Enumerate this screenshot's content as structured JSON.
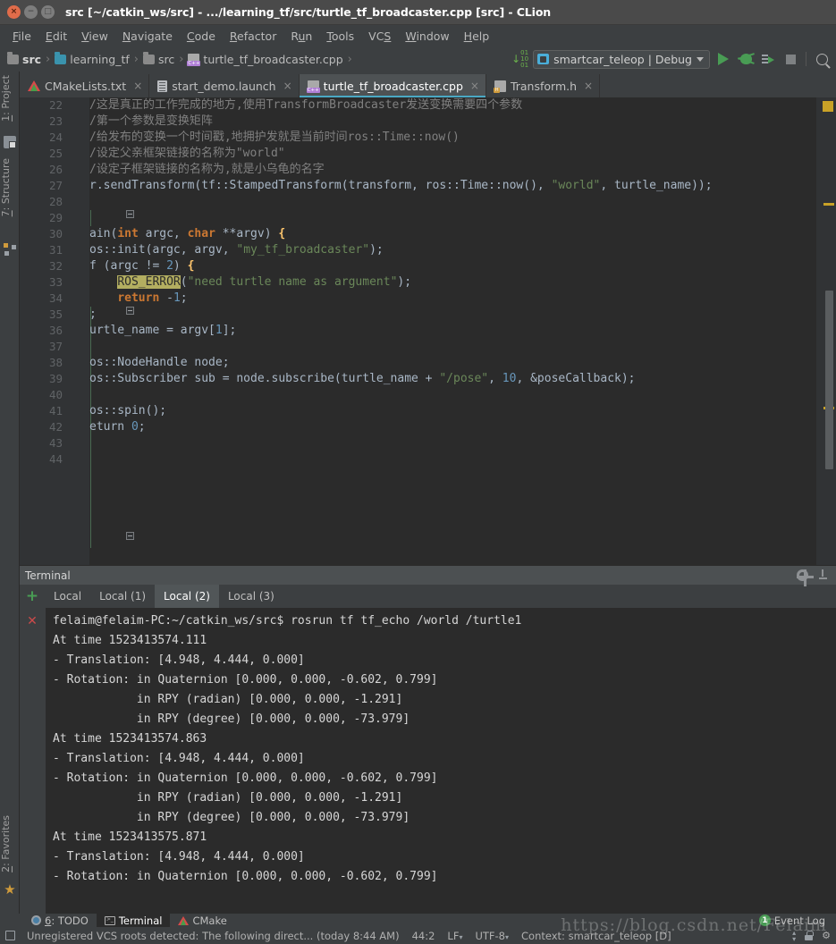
{
  "window": {
    "title": "src [~/catkin_ws/src] - .../learning_tf/src/turtle_tf_broadcaster.cpp [src] - CLion",
    "close_glyph": "×",
    "min_glyph": "−",
    "max_glyph": "□"
  },
  "menubar": {
    "items": [
      {
        "pre": "",
        "mn": "F",
        "post": "ile"
      },
      {
        "pre": "",
        "mn": "E",
        "post": "dit"
      },
      {
        "pre": "",
        "mn": "V",
        "post": "iew"
      },
      {
        "pre": "",
        "mn": "N",
        "post": "avigate"
      },
      {
        "pre": "",
        "mn": "C",
        "post": "ode"
      },
      {
        "pre": "",
        "mn": "R",
        "post": "efactor"
      },
      {
        "pre": "R",
        "mn": "u",
        "post": "n"
      },
      {
        "pre": "",
        "mn": "T",
        "post": "ools"
      },
      {
        "pre": "VC",
        "mn": "S",
        "post": ""
      },
      {
        "pre": "",
        "mn": "W",
        "post": "indow"
      },
      {
        "pre": "",
        "mn": "H",
        "post": "elp"
      }
    ]
  },
  "breadcrumbs": {
    "separator": "›",
    "items": [
      {
        "label": "src",
        "icon": "folder-icon",
        "bold": true
      },
      {
        "label": "learning_tf",
        "icon": "folder-blue-icon",
        "bold": false
      },
      {
        "label": "src",
        "icon": "folder-icon",
        "bold": false
      },
      {
        "label": "turtle_tf_broadcaster.cpp",
        "icon": "cpp-file-icon",
        "bold": false
      }
    ]
  },
  "toolbar": {
    "run_config": "smartcar_teleop | Debug",
    "sort_icon": "sort-numeric-icon",
    "run_icon": "run-icon",
    "debug_icon": "debug-icon",
    "attach_icon": "attach-to-process-icon",
    "stop_icon": "stop-icon",
    "search_icon": "search-everywhere-icon"
  },
  "left_strip": {
    "project": {
      "pre": "",
      "mn": "1",
      "post": ": Project"
    },
    "structure": {
      "pre": "",
      "mn": "7",
      "post": ": Structure"
    },
    "favorites": {
      "pre": "",
      "mn": "2",
      "post": ": Favorites"
    }
  },
  "editor_tabs": [
    {
      "label": "CMakeLists.txt",
      "icon": "cmake-icon",
      "active": false,
      "close": "×"
    },
    {
      "label": "start_demo.launch",
      "icon": "launch-file-icon",
      "active": false,
      "close": "×"
    },
    {
      "label": "turtle_tf_broadcaster.cpp",
      "icon": "cpp-file-icon",
      "active": true,
      "close": "×"
    },
    {
      "label": "Transform.h",
      "icon": "header-file-icon",
      "active": false,
      "close": "×"
    }
  ],
  "editor": {
    "first_line": 22,
    "last_line": 44,
    "line_numbers": [
      22,
      23,
      24,
      25,
      26,
      27,
      28,
      29,
      30,
      31,
      32,
      33,
      34,
      35,
      36,
      37,
      38,
      39,
      40,
      41,
      42,
      43,
      44
    ],
    "lines": [
      {
        "n": 22,
        "text": "/这是真正的工作完成的地方,使用TransformBroadcaster发送变换需要四个参数"
      },
      {
        "n": 23,
        "text": "/第一个参数是变换矩阵"
      },
      {
        "n": 24,
        "text": "/给发布的变换一个时间戳,地拥护发就是当前时间ros::Time::now()"
      },
      {
        "n": 25,
        "text": "/设定父亲框架链接的名称为\"world\""
      },
      {
        "n": 26,
        "text": "/设定子框架链接的名称为,就是小乌龟的名字"
      },
      {
        "n": 27,
        "text": "r.sendTransform(tf::StampedTransform(transform, ros::Time::now(), \"world\", turtle_name));"
      },
      {
        "n": 28,
        "text": ""
      },
      {
        "n": 29,
        "text": ""
      },
      {
        "n": 30,
        "text": "ain(int argc, char **argv) {"
      },
      {
        "n": 31,
        "text": "os::init(argc, argv, \"my_tf_broadcaster\");"
      },
      {
        "n": 32,
        "text": "f (argc != 2) {"
      },
      {
        "n": 33,
        "text": "    ROS_ERROR(\"need turtle name as argument\");"
      },
      {
        "n": 34,
        "text": "    return -1;"
      },
      {
        "n": 35,
        "text": ";"
      },
      {
        "n": 36,
        "text": "urtle_name = argv[1];"
      },
      {
        "n": 37,
        "text": ""
      },
      {
        "n": 38,
        "text": "os::NodeHandle node;"
      },
      {
        "n": 39,
        "text": "os::Subscriber sub = node.subscribe(turtle_name + \"/pose\", 10, &poseCallback);"
      },
      {
        "n": 40,
        "text": ""
      },
      {
        "n": 41,
        "text": "os::spin();"
      },
      {
        "n": 42,
        "text": "eturn 0;"
      },
      {
        "n": 43,
        "text": ""
      },
      {
        "n": 44,
        "text": ""
      }
    ]
  },
  "terminal": {
    "panel_title": "Terminal",
    "gear_icon": "settings-gear-icon",
    "hide_icon": "hide-panel-icon",
    "add_tab": "+",
    "tabs": [
      {
        "label": "Local",
        "active": false
      },
      {
        "label": "Local (1)",
        "active": false
      },
      {
        "label": "Local (2)",
        "active": true
      },
      {
        "label": "Local (3)",
        "active": false
      }
    ],
    "close_session_icon": "close-session-icon",
    "output": [
      "felaim@felaim-PC:~/catkin_ws/src$ rosrun tf tf_echo /world /turtle1",
      "At time 1523413574.111",
      "- Translation: [4.948, 4.444, 0.000]",
      "- Rotation: in Quaternion [0.000, 0.000, -0.602, 0.799]",
      "            in RPY (radian) [0.000, 0.000, -1.291]",
      "            in RPY (degree) [0.000, 0.000, -73.979]",
      "At time 1523413574.863",
      "- Translation: [4.948, 4.444, 0.000]",
      "- Rotation: in Quaternion [0.000, 0.000, -0.602, 0.799]",
      "            in RPY (radian) [0.000, 0.000, -1.291]",
      "            in RPY (degree) [0.000, 0.000, -73.979]",
      "At time 1523413575.871",
      "- Translation: [4.948, 4.444, 0.000]",
      "- Rotation: in Quaternion [0.000, 0.000, -0.602, 0.799]"
    ]
  },
  "bottom_bar": {
    "todo": {
      "pre": "",
      "mn": "6",
      "post": ": TODO"
    },
    "terminal": "Terminal",
    "cmake": "CMake",
    "event_log": "Event Log",
    "event_log_badge": "1"
  },
  "status_bar": {
    "message": "Unregistered VCS roots detected: The following direct... (today 8:44 AM)",
    "caret": "44:2",
    "line_sep": "LF",
    "encoding": "UTF-8",
    "context": "Context: smartcar_teleop [D]"
  },
  "watermark": "https://blog.csdn.net/Felaim",
  "colors": {
    "accent_blue": "#4aa8c4",
    "green_run": "#499c54",
    "editor_bg": "#2b2b2b",
    "chrome_bg": "#3c3f41",
    "titlebar_bg": "#4a4a4a",
    "comment": "#808080",
    "keyword": "#cc7832",
    "string": "#6a8759",
    "number": "#6897bb",
    "macro_highlight": "#b3ae60"
  }
}
